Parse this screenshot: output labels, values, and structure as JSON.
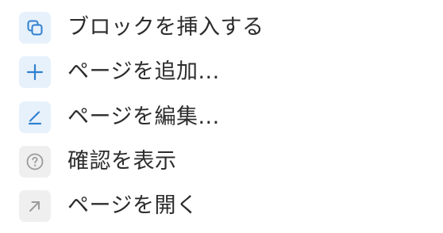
{
  "menu": {
    "items": [
      {
        "label": "ブロックを挿入する",
        "icon": "copy-block-icon",
        "icon_color": "#2f80d1",
        "icon_bg": "#e7f1fb"
      },
      {
        "label": "ページを追加...",
        "icon": "plus-icon",
        "icon_color": "#2f80d1",
        "icon_bg": "#e7f1fb"
      },
      {
        "label": "ページを編集...",
        "icon": "pencil-icon",
        "icon_color": "#2f80d1",
        "icon_bg": "#e7f1fb"
      },
      {
        "label": "確認を表示",
        "icon": "help-circle-icon",
        "icon_color": "#9b9b9b",
        "icon_bg": "#efefef"
      },
      {
        "label": "ページを開く",
        "icon": "arrow-up-left-icon",
        "icon_color": "#9b9b9b",
        "icon_bg": "#efefef"
      }
    ]
  }
}
